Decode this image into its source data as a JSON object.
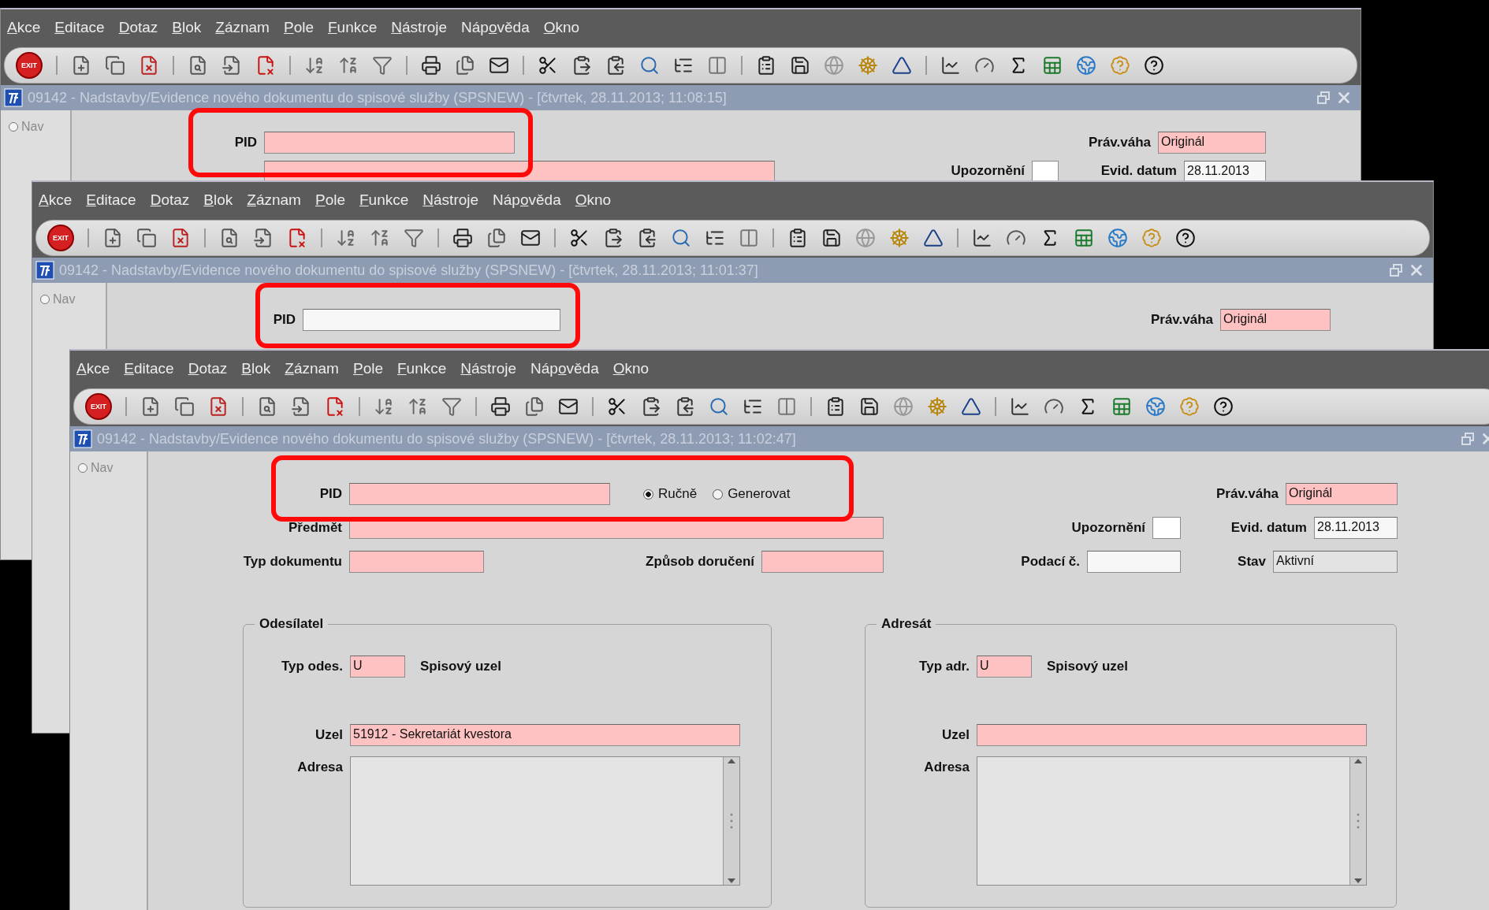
{
  "windows": [
    {
      "menu": [
        {
          "key": "A",
          "post": "kce"
        },
        {
          "key": "E",
          "post": "ditace"
        },
        {
          "key": "D",
          "post": "otaz"
        },
        {
          "key": "B",
          "post": "lok"
        },
        {
          "key": "Z",
          "post": "áznam"
        },
        {
          "key": "P",
          "post": "ole"
        },
        {
          "key": "F",
          "post": "unkce"
        },
        {
          "key": "N",
          "post": "ástroje"
        },
        {
          "pre": "Náp",
          "key": "o",
          "post": "věda"
        },
        {
          "key": "O",
          "post": "kno"
        }
      ],
      "exit_label": "EXIT",
      "title": "09142 - Nadstavby/Evidence nového dokumentu do spisové služby (SPSNEW) - [čtvrtek, 28.11.2013; 11:08:15]",
      "nav": {
        "label": "Nav",
        "selected": false
      },
      "highlighted": true,
      "lines": [
        {
          "fields": [
            {
              "kind": "field",
              "label": "PID",
              "required": true,
              "disabled": false
            },
            {
              "kind": "field",
              "label": "Práv.váha",
              "value": "Originál",
              "required": true,
              "disabled": false
            }
          ]
        },
        {
          "fields": [
            {
              "kind": "field",
              "required": true,
              "disabled": false
            },
            {
              "kind": "checkbox",
              "label": "Upozornění",
              "checked": false
            },
            {
              "kind": "field",
              "label": "Evid. datum",
              "value": "28.11.2013",
              "required": false,
              "disabled": false
            }
          ]
        }
      ]
    },
    {
      "menu": [
        {
          "key": "A",
          "post": "kce"
        },
        {
          "key": "E",
          "post": "ditace"
        },
        {
          "key": "D",
          "post": "otaz"
        },
        {
          "key": "B",
          "post": "lok"
        },
        {
          "key": "Z",
          "post": "áznam"
        },
        {
          "key": "P",
          "post": "ole"
        },
        {
          "key": "F",
          "post": "unkce"
        },
        {
          "key": "N",
          "post": "ástroje"
        },
        {
          "pre": "Náp",
          "key": "o",
          "post": "věda"
        },
        {
          "key": "O",
          "post": "kno"
        }
      ],
      "exit_label": "EXIT",
      "title": "09142 - Nadstavby/Evidence nového dokumentu do spisové služby (SPSNEW) - [čtvrtek, 28.11.2013; 11:01:37]",
      "nav": {
        "label": "Nav",
        "selected": false
      },
      "highlighted": true,
      "lines": [
        {
          "fields": [
            {
              "kind": "field",
              "label": "PID",
              "required": false,
              "disabled": false
            },
            {
              "kind": "field",
              "label": "Práv.váha",
              "value": "Originál",
              "required": true,
              "disabled": false
            }
          ]
        }
      ]
    },
    {
      "menu": [
        {
          "key": "A",
          "post": "kce"
        },
        {
          "key": "E",
          "post": "ditace"
        },
        {
          "key": "D",
          "post": "otaz"
        },
        {
          "key": "B",
          "post": "lok"
        },
        {
          "key": "Z",
          "post": "áznam"
        },
        {
          "key": "P",
          "post": "ole"
        },
        {
          "key": "F",
          "post": "unkce"
        },
        {
          "key": "N",
          "post": "ástroje"
        },
        {
          "pre": "Náp",
          "key": "o",
          "post": "věda"
        },
        {
          "key": "O",
          "post": "kno"
        }
      ],
      "exit_label": "EXIT",
      "title": "09142 - Nadstavby/Evidence nového dokumentu do spisové služby (SPSNEW) - [čtvrtek, 28.11.2013; 11:02:47]",
      "nav": {
        "label": "Nav",
        "selected": false
      },
      "highlighted": true,
      "lines": [
        {
          "fields": [
            {
              "kind": "field",
              "label": "PID",
              "required": true,
              "disabled": false
            },
            {
              "kind": "radios",
              "options": [
                {
                  "label": "Ručně",
                  "selected": true
                },
                {
                  "label": "Generovat",
                  "selected": false
                }
              ]
            },
            {
              "kind": "field",
              "label": "Práv.váha",
              "value": "Originál",
              "required": true,
              "disabled": false
            }
          ]
        },
        {
          "fields": [
            {
              "kind": "field",
              "label": "Předmět",
              "required": true,
              "disabled": false
            },
            {
              "kind": "checkbox",
              "label": "Upozornění",
              "checked": false
            },
            {
              "kind": "field",
              "label": "Evid. datum",
              "value": "28.11.2013",
              "required": false,
              "disabled": false
            }
          ]
        },
        {
          "fields": [
            {
              "kind": "field",
              "label": "Typ dokumentu",
              "required": true,
              "disabled": false
            },
            {
              "kind": "field",
              "label": "Způsob doručení",
              "required": true,
              "disabled": false
            },
            {
              "kind": "field",
              "label": "Podací č.",
              "required": false,
              "disabled": false
            },
            {
              "kind": "field",
              "label": "Stav",
              "value": "Aktivní",
              "required": false,
              "disabled": true
            }
          ]
        }
      ],
      "groups": [
        {
          "title": "Odesílatel",
          "type_label": "Typ odes.",
          "type_value": "U",
          "type_name": "Spisový uzel",
          "node_label": "Uzel",
          "node_value": "51912 - Sekretariát kvestora",
          "address_label": "Adresa"
        },
        {
          "title": "Adresát",
          "type_label": "Typ adr.",
          "type_value": "U",
          "type_name": "Spisový uzel",
          "node_label": "Uzel",
          "address_label": "Adresa"
        }
      ]
    }
  ]
}
